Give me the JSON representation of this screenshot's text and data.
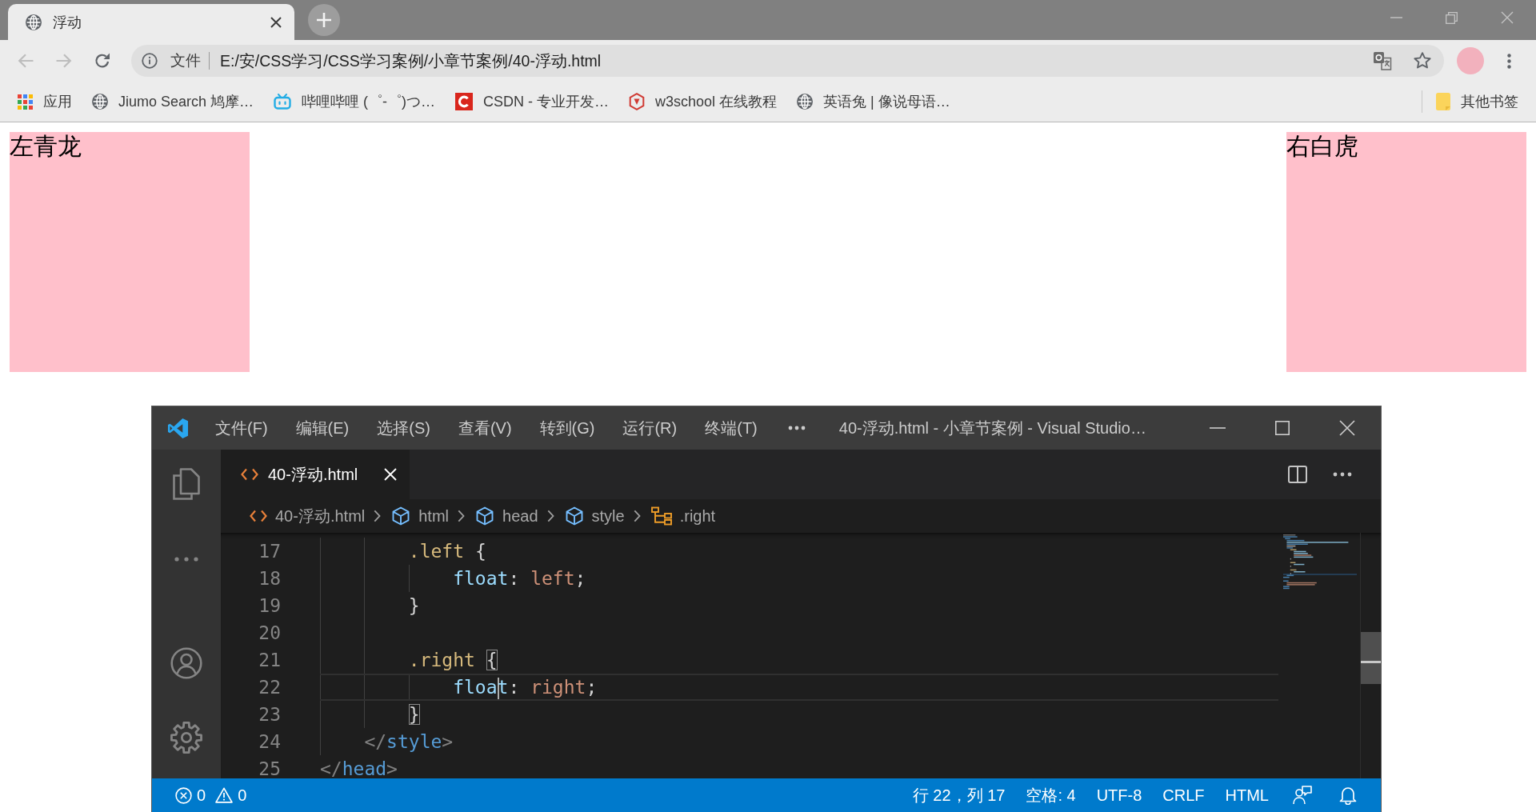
{
  "browser": {
    "tabs": [
      {
        "title": "浮动",
        "selected": true
      }
    ],
    "nav_buttons": [
      {
        "kind": "back",
        "disabled": true
      },
      {
        "kind": "forward",
        "disabled": true
      },
      {
        "kind": "reload",
        "disabled": false
      }
    ],
    "address_bar": {
      "chip": "文件",
      "url": "E:/安/CSS学习/CSS学习案例/小章节案例/40-浮动.html"
    },
    "bookmarks": [
      {
        "kind": "grid",
        "label": "应用"
      },
      {
        "kind": "globe",
        "label": "Jiumo Search 鸠摩…"
      },
      {
        "kind": "tv",
        "label": "哔哩哔哩 (゜-゜)つ…"
      },
      {
        "kind": "tile",
        "label": "CSDN - 专业开发…"
      },
      {
        "kind": "hexagon",
        "label": "w3school 在线教程"
      },
      {
        "kind": "globe",
        "label": "英语兔 | 像说母语…"
      }
    ],
    "other_bookmarks": "其他书签"
  },
  "page": {
    "boxes": [
      {
        "text": "左青龙",
        "kind": "left"
      },
      {
        "text": "右白虎",
        "kind": "right"
      }
    ]
  },
  "editor": {
    "menu": [
      "文件(F)",
      "编辑(E)",
      "选择(S)",
      "查看(V)",
      "转到(G)",
      "运行(R)",
      "终端(T)"
    ],
    "title": "40-浮动.html - 小章节案例 - Visual Studio…",
    "tabs": [
      {
        "label": "40-浮动.html",
        "selected": true
      }
    ],
    "breadcrumbs": [
      {
        "kind": "file",
        "label": "40-浮动.html"
      },
      {
        "kind": "element",
        "label": "html"
      },
      {
        "kind": "element",
        "label": "head"
      },
      {
        "kind": "element",
        "label": "style"
      },
      {
        "kind": "selector",
        "label": ".right"
      }
    ],
    "lines": [
      {
        "number": "17",
        "current": false,
        "tokens": [
          {
            "kind": "selector",
            "text": "        .left "
          },
          {
            "kind": "bracket",
            "text": "{",
            "matched": false
          }
        ]
      },
      {
        "number": "18",
        "current": false,
        "tokens": [
          {
            "kind": "property",
            "text": "            float"
          },
          {
            "kind": "punct",
            "text": ": "
          },
          {
            "kind": "value",
            "text": "left"
          },
          {
            "kind": "punct",
            "text": ";"
          }
        ]
      },
      {
        "number": "19",
        "current": false,
        "tokens": [
          {
            "kind": "bracket",
            "text": "        }",
            "matched": false
          }
        ]
      },
      {
        "number": "20",
        "current": false
      },
      {
        "number": "21",
        "current": false,
        "tokens": [
          {
            "kind": "selector",
            "text": "        .right "
          },
          {
            "kind": "bracket",
            "text": "{",
            "matched": true
          }
        ]
      },
      {
        "number": "22",
        "current": true,
        "tokens": [
          {
            "kind": "property",
            "text": "            floa"
          },
          {
            "kind": "cursor"
          },
          {
            "kind": "property",
            "text": "t"
          },
          {
            "kind": "punct",
            "text": ": "
          },
          {
            "kind": "value",
            "text": "right"
          },
          {
            "kind": "punct",
            "text": ";"
          }
        ]
      },
      {
        "number": "23",
        "current": false,
        "tokens": [
          {
            "kind": "bracket",
            "text": "        }",
            "matched": true
          }
        ]
      },
      {
        "number": "24",
        "current": false,
        "tokens": [
          {
            "kind": "tag_bracket",
            "text": "    </"
          },
          {
            "kind": "tag",
            "text": "style"
          },
          {
            "kind": "tag_bracket",
            "text": ">"
          }
        ]
      },
      {
        "number": "25",
        "current": false,
        "tokens": [
          {
            "kind": "tag_bracket",
            "text": "</"
          },
          {
            "kind": "tag",
            "text": "head"
          },
          {
            "kind": "tag_bracket",
            "text": ">"
          }
        ]
      }
    ],
    "status_bar": {
      "errors": "0",
      "warnings": "0",
      "items": [
        "行 22，列 17",
        "空格: 4",
        "UTF-8",
        "CRLF",
        "HTML"
      ]
    }
  }
}
